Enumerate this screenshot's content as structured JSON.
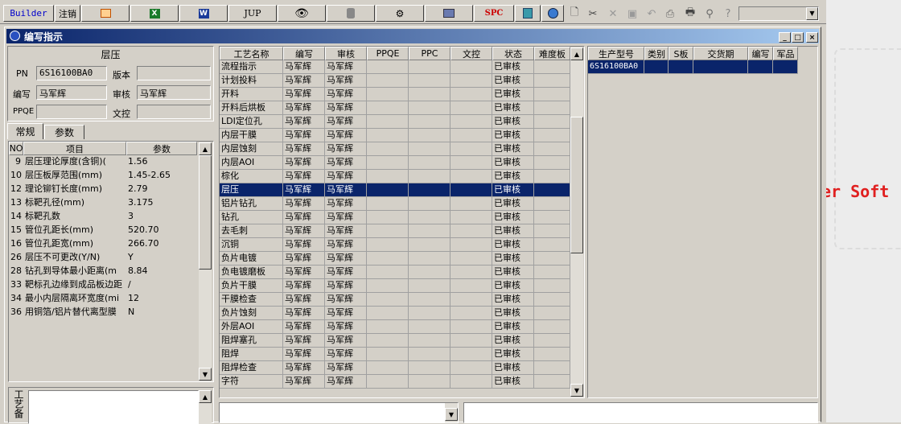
{
  "toolbar": {
    "builder": "Builder",
    "logout": "注销",
    "jup": "JUP",
    "spc": "SPC"
  },
  "background": {
    "text": "er Soft"
  },
  "window": {
    "title": "编写指示"
  },
  "header": {
    "panel_title": "层压",
    "pn_label": "PN",
    "pn_value": "6S16100BA0",
    "version_label": "版本",
    "version_value": "",
    "writer_label": "编写",
    "writer_value": "马军辉",
    "reviewer_label": "审核",
    "reviewer_value": "马军辉",
    "ppqe_label": "PPQE",
    "ppqe_value": "",
    "doccontrol_label": "文控",
    "doccontrol_value": ""
  },
  "tabs": [
    {
      "label": "常规"
    },
    {
      "label": "参数"
    }
  ],
  "params": {
    "headers": [
      "NO",
      "项目",
      "参数"
    ],
    "rows": [
      {
        "no": "9",
        "item": "层压理论厚度(含铜)(",
        "value": "1.56"
      },
      {
        "no": "10",
        "item": "层压板厚范围(mm)",
        "value": "1.45-2.65"
      },
      {
        "no": "12",
        "item": "理论铆钉长度(mm)",
        "value": "2.79"
      },
      {
        "no": "13",
        "item": "标靶孔径(mm)",
        "value": "3.175"
      },
      {
        "no": "14",
        "item": "标靶孔数",
        "value": "3"
      },
      {
        "no": "15",
        "item": "管位孔距长(mm)",
        "value": "520.70"
      },
      {
        "no": "16",
        "item": "管位孔距宽(mm)",
        "value": "266.70"
      },
      {
        "no": "26",
        "item": "层压不可更改(Y/N)",
        "value": "Y"
      },
      {
        "no": "28",
        "item": "钻孔到导体最小距离(m",
        "value": "8.84"
      },
      {
        "no": "33",
        "item": "靶标孔边缘到成品板边距",
        "value": "/"
      },
      {
        "no": "34",
        "item": "最小内层隔离环宽度(mi",
        "value": "12"
      },
      {
        "no": "36",
        "item": "用铜箔/铝片替代离型膜",
        "value": "N"
      }
    ]
  },
  "bottom_left_label": "工艺备",
  "process": {
    "headers": [
      "工艺名称",
      "编写",
      "审核",
      "PPQE",
      "PPC",
      "文控",
      "状态",
      "难度板"
    ],
    "rows": [
      {
        "name": "流程指示",
        "writer": "马军辉",
        "reviewer": "马军辉",
        "status": "已审核"
      },
      {
        "name": "计划投料",
        "writer": "马军辉",
        "reviewer": "马军辉",
        "status": "已审核"
      },
      {
        "name": "开料",
        "writer": "马军辉",
        "reviewer": "马军辉",
        "status": "已审核"
      },
      {
        "name": "开料后烘板",
        "writer": "马军辉",
        "reviewer": "马军辉",
        "status": "已审核"
      },
      {
        "name": "LDI定位孔",
        "writer": "马军辉",
        "reviewer": "马军辉",
        "status": "已审核"
      },
      {
        "name": "内层干膜",
        "writer": "马军辉",
        "reviewer": "马军辉",
        "status": "已审核"
      },
      {
        "name": "内层蚀刻",
        "writer": "马军辉",
        "reviewer": "马军辉",
        "status": "已审核"
      },
      {
        "name": "内层AOI",
        "writer": "马军辉",
        "reviewer": "马军辉",
        "status": "已审核"
      },
      {
        "name": "棕化",
        "writer": "马军辉",
        "reviewer": "马军辉",
        "status": "已审核"
      },
      {
        "name": "层压",
        "writer": "马军辉",
        "reviewer": "马军辉",
        "status": "已审核"
      },
      {
        "name": "铝片钻孔",
        "writer": "马军辉",
        "reviewer": "马军辉",
        "status": "已审核"
      },
      {
        "name": "钻孔",
        "writer": "马军辉",
        "reviewer": "马军辉",
        "status": "已审核"
      },
      {
        "name": "去毛刺",
        "writer": "马军辉",
        "reviewer": "马军辉",
        "status": "已审核"
      },
      {
        "name": "沉铜",
        "writer": "马军辉",
        "reviewer": "马军辉",
        "status": "已审核"
      },
      {
        "name": "负片电镀",
        "writer": "马军辉",
        "reviewer": "马军辉",
        "status": "已审核"
      },
      {
        "name": "负电镀磨板",
        "writer": "马军辉",
        "reviewer": "马军辉",
        "status": "已审核"
      },
      {
        "name": "负片干膜",
        "writer": "马军辉",
        "reviewer": "马军辉",
        "status": "已审核"
      },
      {
        "name": "干膜检查",
        "writer": "马军辉",
        "reviewer": "马军辉",
        "status": "已审核"
      },
      {
        "name": "负片蚀刻",
        "writer": "马军辉",
        "reviewer": "马军辉",
        "status": "已审核"
      },
      {
        "name": "外层AOI",
        "writer": "马军辉",
        "reviewer": "马军辉",
        "status": "已审核"
      },
      {
        "name": "阻焊塞孔",
        "writer": "马军辉",
        "reviewer": "马军辉",
        "status": "已审核"
      },
      {
        "name": "阻焊",
        "writer": "马军辉",
        "reviewer": "马军辉",
        "status": "已审核"
      },
      {
        "name": "阻焊检查",
        "writer": "马军辉",
        "reviewer": "马军辉",
        "status": "已审核"
      },
      {
        "name": "字符",
        "writer": "马军辉",
        "reviewer": "马军辉",
        "status": "已审核"
      }
    ],
    "selected_index": 9
  },
  "products": {
    "headers": [
      "生产型号",
      "类别",
      "S板",
      "交货期",
      "编写",
      "军品"
    ],
    "rows": [
      {
        "model": "6S16100BA0",
        "category": "",
        "s_board": "",
        "delivery": "",
        "writer": "",
        "military": ""
      }
    ]
  },
  "colors": {
    "selection": "#0a246a",
    "spc": "#cc0000",
    "builder": "#0000cc"
  }
}
